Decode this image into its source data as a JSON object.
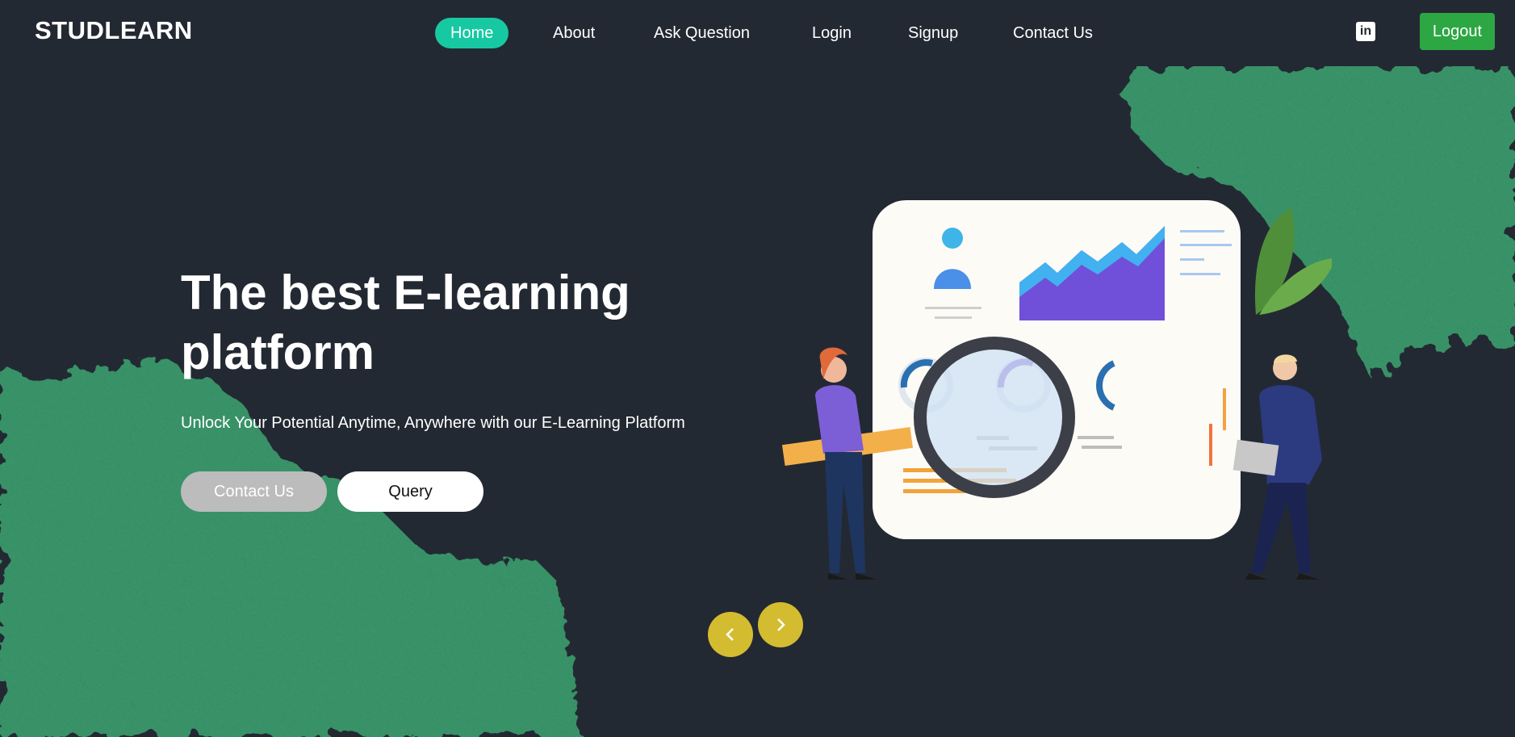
{
  "navbar": {
    "brand": "STUDLEARN",
    "links": [
      {
        "label": "Home",
        "active": true
      },
      {
        "label": "About",
        "active": false
      },
      {
        "label": "Ask Question",
        "active": false
      },
      {
        "label": "Login",
        "active": false
      },
      {
        "label": "Signup",
        "active": false
      },
      {
        "label": "Contact Us",
        "active": false
      }
    ],
    "linkedin_icon": "linkedin-icon",
    "logout_label": "Logout"
  },
  "hero": {
    "title": "The best E-learning platform",
    "subtitle": "Unlock Your Potential Anytime, Anywhere with our E-Learning Platform",
    "contact_button": "Contact Us",
    "query_button": "Query"
  },
  "carousel": {
    "prev_icon": "chevron-left-icon",
    "next_icon": "chevron-right-icon"
  },
  "colors": {
    "background": "#232932",
    "active_nav": "#17c9a2",
    "logout": "#2ca744",
    "texture_green": "#2f8a5c",
    "arrow": "#d4bc30"
  }
}
